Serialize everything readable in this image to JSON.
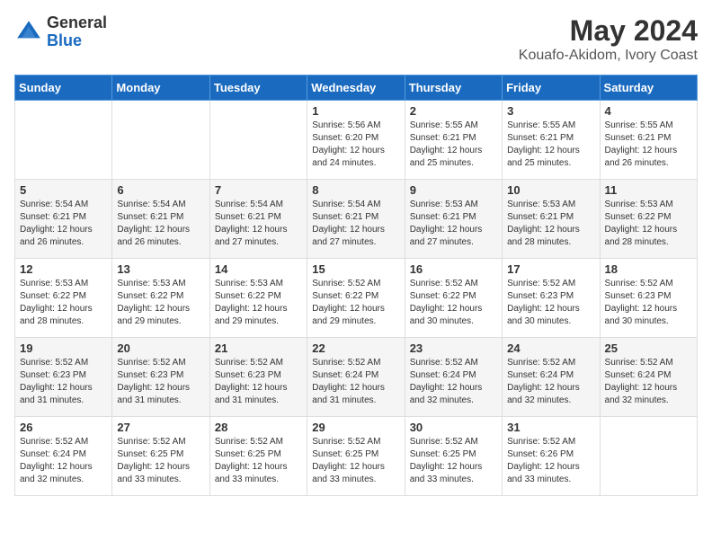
{
  "logo": {
    "general": "General",
    "blue": "Blue"
  },
  "title": {
    "month_year": "May 2024",
    "location": "Kouafo-Akidom, Ivory Coast"
  },
  "days_of_week": [
    "Sunday",
    "Monday",
    "Tuesday",
    "Wednesday",
    "Thursday",
    "Friday",
    "Saturday"
  ],
  "weeks": [
    [
      {
        "day": "",
        "info": ""
      },
      {
        "day": "",
        "info": ""
      },
      {
        "day": "",
        "info": ""
      },
      {
        "day": "1",
        "info": "Sunrise: 5:56 AM\nSunset: 6:20 PM\nDaylight: 12 hours\nand 24 minutes."
      },
      {
        "day": "2",
        "info": "Sunrise: 5:55 AM\nSunset: 6:21 PM\nDaylight: 12 hours\nand 25 minutes."
      },
      {
        "day": "3",
        "info": "Sunrise: 5:55 AM\nSunset: 6:21 PM\nDaylight: 12 hours\nand 25 minutes."
      },
      {
        "day": "4",
        "info": "Sunrise: 5:55 AM\nSunset: 6:21 PM\nDaylight: 12 hours\nand 26 minutes."
      }
    ],
    [
      {
        "day": "5",
        "info": "Sunrise: 5:54 AM\nSunset: 6:21 PM\nDaylight: 12 hours\nand 26 minutes."
      },
      {
        "day": "6",
        "info": "Sunrise: 5:54 AM\nSunset: 6:21 PM\nDaylight: 12 hours\nand 26 minutes."
      },
      {
        "day": "7",
        "info": "Sunrise: 5:54 AM\nSunset: 6:21 PM\nDaylight: 12 hours\nand 27 minutes."
      },
      {
        "day": "8",
        "info": "Sunrise: 5:54 AM\nSunset: 6:21 PM\nDaylight: 12 hours\nand 27 minutes."
      },
      {
        "day": "9",
        "info": "Sunrise: 5:53 AM\nSunset: 6:21 PM\nDaylight: 12 hours\nand 27 minutes."
      },
      {
        "day": "10",
        "info": "Sunrise: 5:53 AM\nSunset: 6:21 PM\nDaylight: 12 hours\nand 28 minutes."
      },
      {
        "day": "11",
        "info": "Sunrise: 5:53 AM\nSunset: 6:22 PM\nDaylight: 12 hours\nand 28 minutes."
      }
    ],
    [
      {
        "day": "12",
        "info": "Sunrise: 5:53 AM\nSunset: 6:22 PM\nDaylight: 12 hours\nand 28 minutes."
      },
      {
        "day": "13",
        "info": "Sunrise: 5:53 AM\nSunset: 6:22 PM\nDaylight: 12 hours\nand 29 minutes."
      },
      {
        "day": "14",
        "info": "Sunrise: 5:53 AM\nSunset: 6:22 PM\nDaylight: 12 hours\nand 29 minutes."
      },
      {
        "day": "15",
        "info": "Sunrise: 5:52 AM\nSunset: 6:22 PM\nDaylight: 12 hours\nand 29 minutes."
      },
      {
        "day": "16",
        "info": "Sunrise: 5:52 AM\nSunset: 6:22 PM\nDaylight: 12 hours\nand 30 minutes."
      },
      {
        "day": "17",
        "info": "Sunrise: 5:52 AM\nSunset: 6:23 PM\nDaylight: 12 hours\nand 30 minutes."
      },
      {
        "day": "18",
        "info": "Sunrise: 5:52 AM\nSunset: 6:23 PM\nDaylight: 12 hours\nand 30 minutes."
      }
    ],
    [
      {
        "day": "19",
        "info": "Sunrise: 5:52 AM\nSunset: 6:23 PM\nDaylight: 12 hours\nand 31 minutes."
      },
      {
        "day": "20",
        "info": "Sunrise: 5:52 AM\nSunset: 6:23 PM\nDaylight: 12 hours\nand 31 minutes."
      },
      {
        "day": "21",
        "info": "Sunrise: 5:52 AM\nSunset: 6:23 PM\nDaylight: 12 hours\nand 31 minutes."
      },
      {
        "day": "22",
        "info": "Sunrise: 5:52 AM\nSunset: 6:24 PM\nDaylight: 12 hours\nand 31 minutes."
      },
      {
        "day": "23",
        "info": "Sunrise: 5:52 AM\nSunset: 6:24 PM\nDaylight: 12 hours\nand 32 minutes."
      },
      {
        "day": "24",
        "info": "Sunrise: 5:52 AM\nSunset: 6:24 PM\nDaylight: 12 hours\nand 32 minutes."
      },
      {
        "day": "25",
        "info": "Sunrise: 5:52 AM\nSunset: 6:24 PM\nDaylight: 12 hours\nand 32 minutes."
      }
    ],
    [
      {
        "day": "26",
        "info": "Sunrise: 5:52 AM\nSunset: 6:24 PM\nDaylight: 12 hours\nand 32 minutes."
      },
      {
        "day": "27",
        "info": "Sunrise: 5:52 AM\nSunset: 6:25 PM\nDaylight: 12 hours\nand 33 minutes."
      },
      {
        "day": "28",
        "info": "Sunrise: 5:52 AM\nSunset: 6:25 PM\nDaylight: 12 hours\nand 33 minutes."
      },
      {
        "day": "29",
        "info": "Sunrise: 5:52 AM\nSunset: 6:25 PM\nDaylight: 12 hours\nand 33 minutes."
      },
      {
        "day": "30",
        "info": "Sunrise: 5:52 AM\nSunset: 6:25 PM\nDaylight: 12 hours\nand 33 minutes."
      },
      {
        "day": "31",
        "info": "Sunrise: 5:52 AM\nSunset: 6:26 PM\nDaylight: 12 hours\nand 33 minutes."
      },
      {
        "day": "",
        "info": ""
      }
    ]
  ]
}
